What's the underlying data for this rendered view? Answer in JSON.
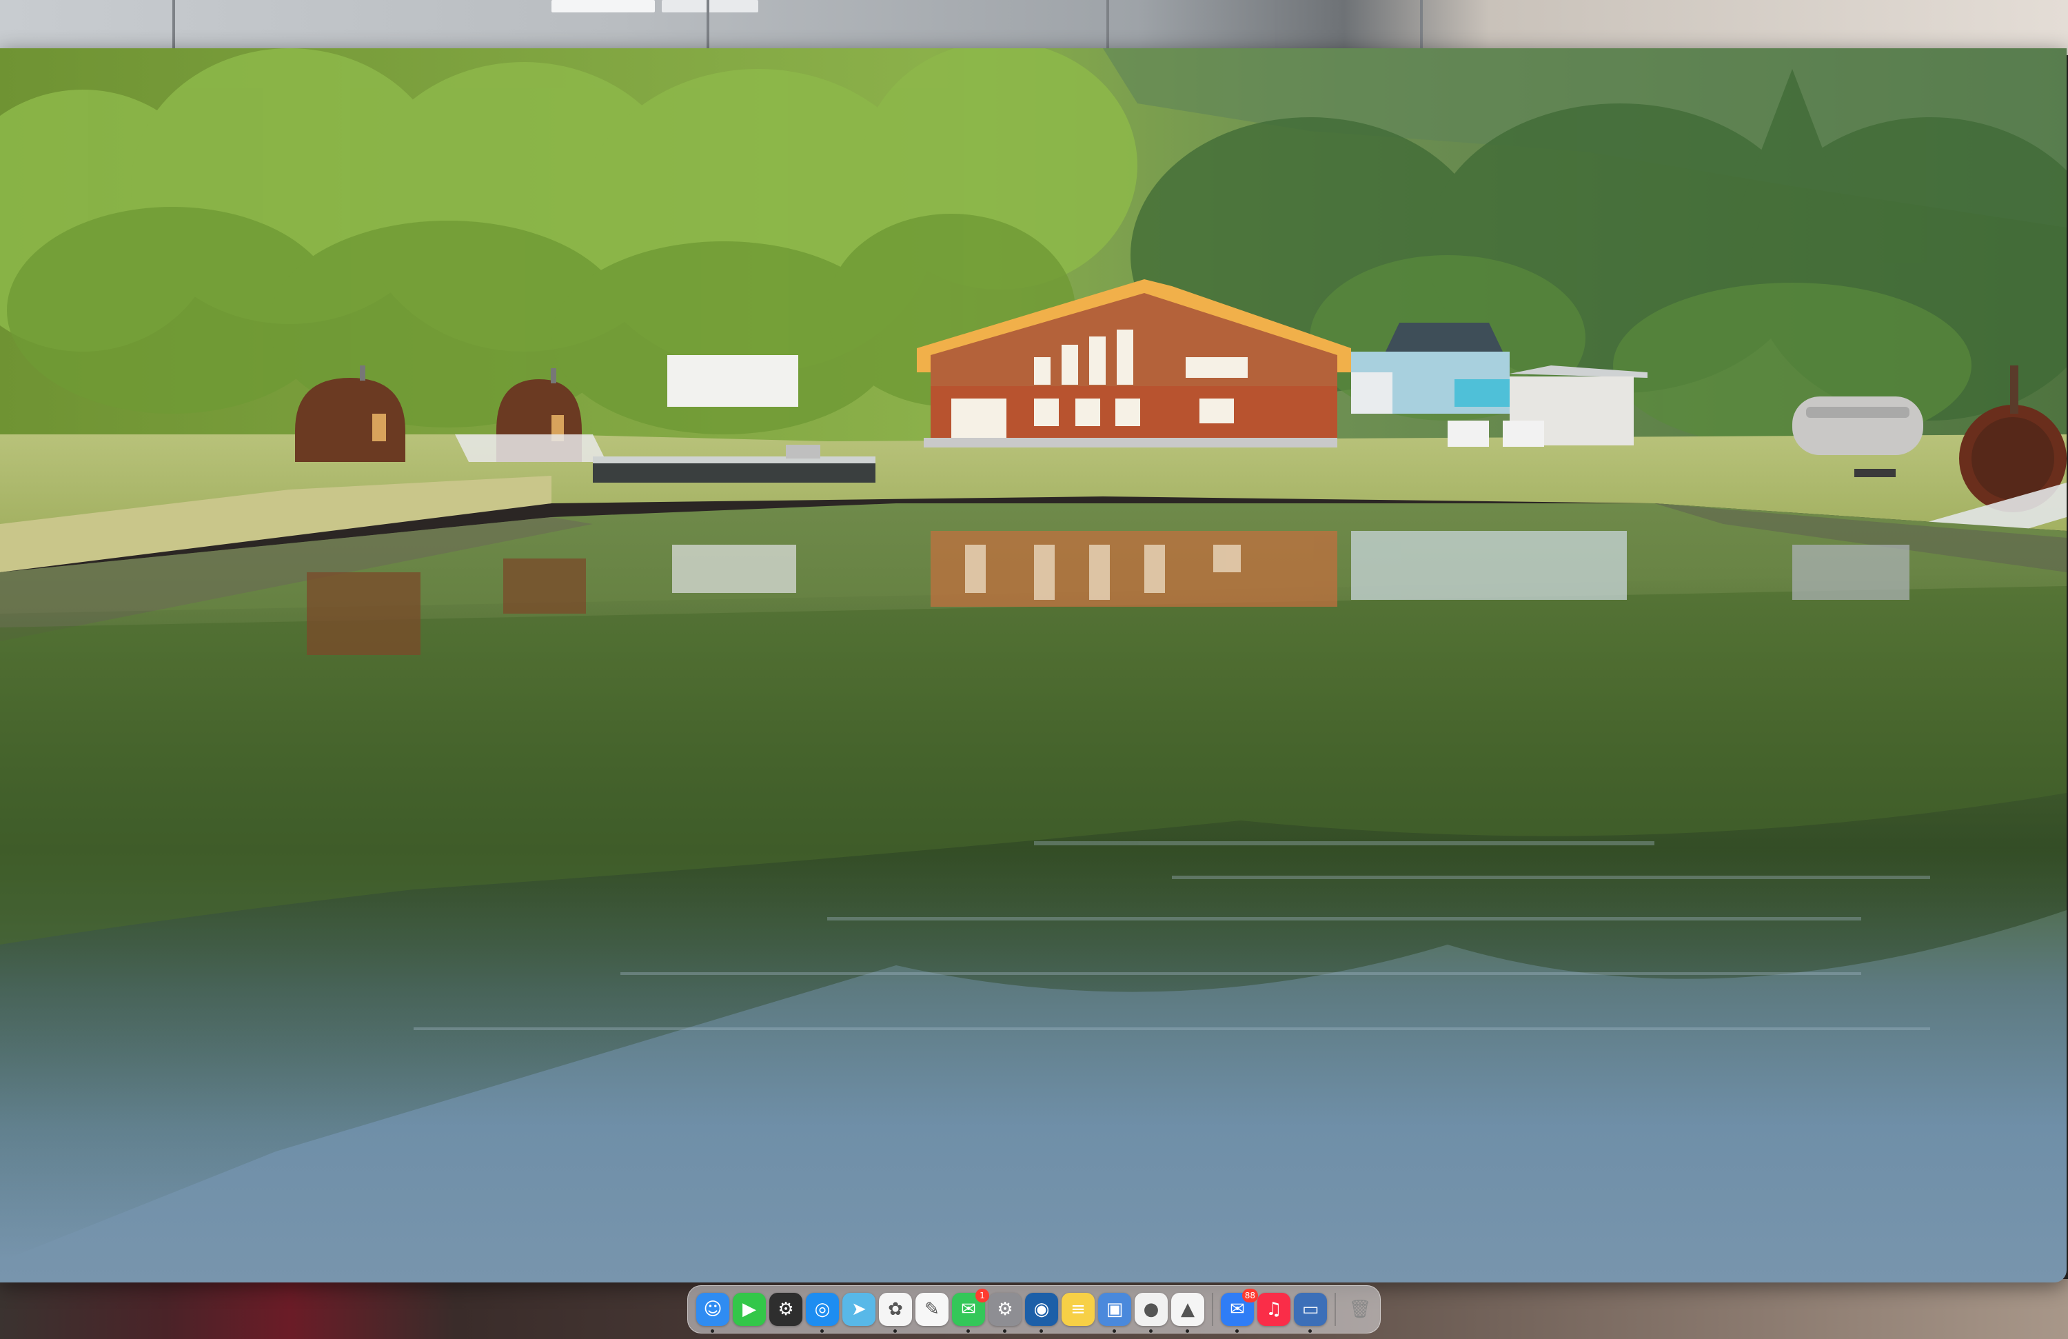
{
  "photo": {
    "subject": "lake-cabin-landscape"
  },
  "dock": {
    "apps": [
      {
        "name": "finder-icon",
        "glyph": "☺",
        "bg": "#2f8cf2",
        "running": true
      },
      {
        "name": "facetime-icon",
        "glyph": "▶",
        "bg": "#33c749",
        "running": false
      },
      {
        "name": "launchpad-icon",
        "glyph": "⚙",
        "bg": "#2e2e2e",
        "running": false
      },
      {
        "name": "safari-icon",
        "glyph": "◎",
        "bg": "#1d8df1",
        "running": true
      },
      {
        "name": "maps-icon",
        "glyph": "➤",
        "bg": "#58b8e8",
        "running": false
      },
      {
        "name": "photos-icon",
        "glyph": "✿",
        "bg": "#f5f5f5",
        "running": true
      },
      {
        "name": "pages-icon",
        "glyph": "✎",
        "bg": "#f7f7f7",
        "running": false
      },
      {
        "name": "messages-icon",
        "glyph": "✉",
        "bg": "#34c759",
        "running": true,
        "badge": "1"
      },
      {
        "name": "system-settings-icon",
        "glyph": "⚙",
        "bg": "#8e8e93",
        "running": true
      },
      {
        "name": "quicktime-icon",
        "glyph": "◉",
        "bg": "#1c5fa8",
        "running": true
      },
      {
        "name": "notes-icon",
        "glyph": "≡",
        "bg": "#f7d046",
        "running": false
      },
      {
        "name": "preview-icon",
        "glyph": "▣",
        "bg": "#4a89dc",
        "running": true
      },
      {
        "name": "chrome-icon",
        "glyph": "●",
        "bg": "#f1f1f1",
        "running": true
      },
      {
        "name": "drive-icon",
        "glyph": "▲",
        "bg": "#f5f5f5",
        "running": true
      },
      {
        "name": "mail-icon",
        "glyph": "✉",
        "bg": "#2f7df6",
        "running": true,
        "badge": "88"
      },
      {
        "name": "music-icon",
        "glyph": "♫",
        "bg": "#fa2d48",
        "running": false
      },
      {
        "name": "remote-desktop-icon",
        "glyph": "▭",
        "bg": "#3c6fb8",
        "running": true
      },
      {
        "name": "trash-icon",
        "glyph": "🗑",
        "bg": "transparent",
        "running": false
      }
    ]
  }
}
